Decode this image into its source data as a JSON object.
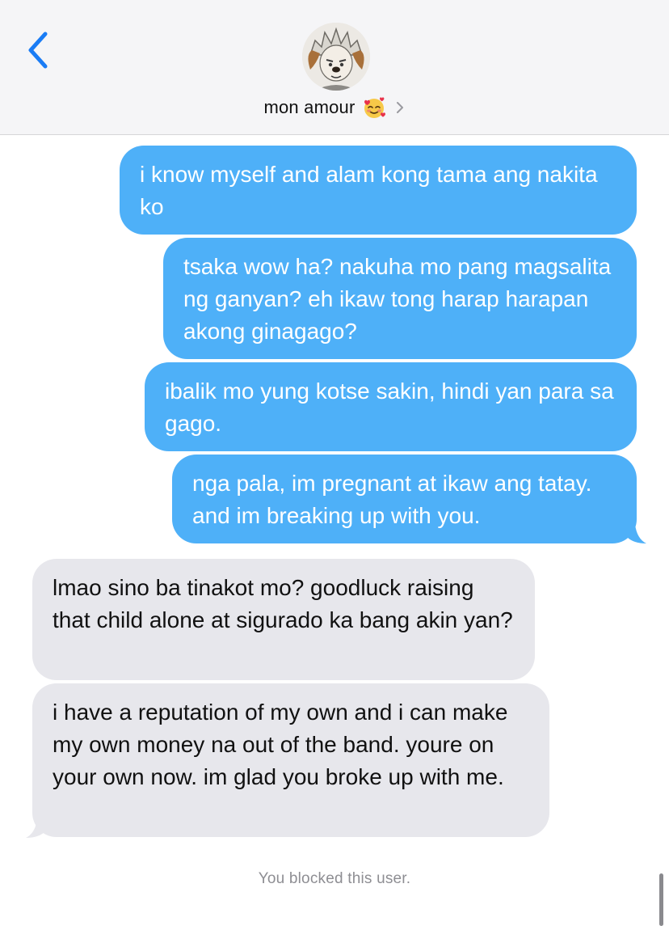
{
  "header": {
    "contact_name": "mon amour",
    "contact_emoji_icon": "smiling-face-with-hearts-icon",
    "back_icon": "chevron-left-icon",
    "details_icon": "chevron-right-icon"
  },
  "messages": [
    {
      "direction": "sent",
      "text": "i know myself and alam kong tama ang nakita ko"
    },
    {
      "direction": "sent",
      "text": "tsaka wow ha? nakuha mo pang magsalita ng ganyan? eh ikaw tong harap harapan akong ginagago?"
    },
    {
      "direction": "sent",
      "text": "ibalik mo yung kotse sakin, hindi yan para sa gago."
    },
    {
      "direction": "sent",
      "text": "nga pala, im pregnant at ikaw ang tatay. and im breaking up with you."
    },
    {
      "direction": "received",
      "text": "lmao sino ba tinakot mo? goodluck raising that child alone at sigurado ka bang akin yan?"
    },
    {
      "direction": "received",
      "text": "i have a reputation of my own and i can make my own money na out of the band. youre on your own now. im glad you broke up with me."
    }
  ],
  "status_note": "You blocked this user.",
  "colors": {
    "sent_bubble": "#4eb0f8",
    "received_bubble": "#e7e7ec",
    "accent": "#1a7cf5",
    "header_bg": "#f5f5f7"
  }
}
